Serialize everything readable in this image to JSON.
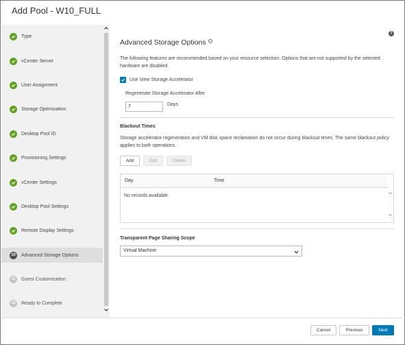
{
  "dialog": {
    "title": "Add Pool - W10_FULL"
  },
  "sidebar": {
    "steps": [
      {
        "label": "Type",
        "state": "done",
        "icon": "check-icon"
      },
      {
        "label": "vCenter Server",
        "state": "done",
        "icon": "check-icon"
      },
      {
        "label": "User Assignment",
        "state": "done",
        "icon": "check-icon"
      },
      {
        "label": "Storage Optimization",
        "state": "done",
        "icon": "check-icon"
      },
      {
        "label": "Desktop Pool ID",
        "state": "done",
        "icon": "check-icon"
      },
      {
        "label": "Provisioning Settings",
        "state": "done",
        "icon": "check-icon"
      },
      {
        "label": "vCenter Settings",
        "state": "done",
        "icon": "check-icon"
      },
      {
        "label": "Desktop Pool Settings",
        "state": "done",
        "icon": "check-icon"
      },
      {
        "label": "Remote Display Settings",
        "state": "done",
        "icon": "check-icon"
      },
      {
        "label": "Advanced Storage Options",
        "state": "current",
        "number": "10"
      },
      {
        "label": "Guest Customization",
        "state": "future",
        "number": "11"
      },
      {
        "label": "Ready to Complete",
        "state": "future",
        "number": "12"
      }
    ]
  },
  "main": {
    "heading": "Advanced Storage Options",
    "help_glyph": "?",
    "info_glyph": "i",
    "intro": "The following features are recommended based on your resource selection. Options that are not supported by the selected hardware are disabled.",
    "accelerator": {
      "checkbox_label": "Use View Storage Accelerator",
      "checked": true,
      "regenerate_label": "Regenerate Storage Accelerator After",
      "regenerate_value": "7",
      "unit": "Days"
    },
    "blackout": {
      "title": "Blackout Times",
      "description": "Storage accelerator regeneration and VM disk space reclamation do not occur during blackout times. The same blackout policy applies to both operations.",
      "buttons": {
        "add": "Add",
        "edit": "Edit",
        "delete": "Delete"
      },
      "columns": [
        "Day",
        "Time"
      ],
      "empty_message": "No records available."
    },
    "tps": {
      "title": "Transparent Page Sharing Scope",
      "selected": "Virtual Machine"
    }
  },
  "footer": {
    "cancel": "Cancel",
    "previous": "Previous",
    "next": "Next"
  },
  "colors": {
    "accent": "#0079b8",
    "done": "#62a420",
    "sidebar_bg": "#f1f1f1"
  }
}
